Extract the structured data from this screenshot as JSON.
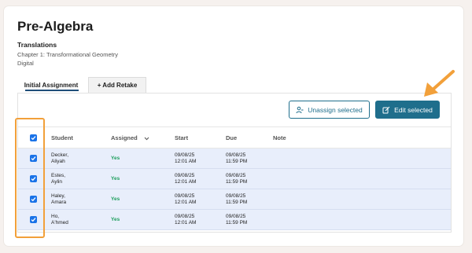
{
  "page": {
    "title": "Pre-Algebra",
    "subtitle": "Translations",
    "chapter": "Chapter 1: Transformational Geometry",
    "format": "Digital"
  },
  "tabs": [
    {
      "label": "Initial Assignment",
      "active": true
    },
    {
      "label": "+ Add Retake",
      "active": false
    }
  ],
  "actions": {
    "unassign_label": "Unassign selected",
    "edit_label": "Edit selected"
  },
  "table": {
    "headers": {
      "student": "Student",
      "assigned": "Assigned",
      "start": "Start",
      "due": "Due",
      "note": "Note"
    },
    "header_checkbox_checked": true,
    "rows": [
      {
        "last": "Decker,",
        "first": "Aliyah",
        "assigned": "Yes",
        "start_date": "09/08/25",
        "start_time": "12:01 AM",
        "due_date": "09/08/25",
        "due_time": "11:59 PM",
        "checked": true
      },
      {
        "last": "Estes,",
        "first": "Aylin",
        "assigned": "Yes",
        "start_date": "09/08/25",
        "start_time": "12:01 AM",
        "due_date": "09/08/25",
        "due_time": "11:59 PM",
        "checked": true
      },
      {
        "last": "Haley,",
        "first": "Amara",
        "assigned": "Yes",
        "start_date": "09/08/25",
        "start_time": "12:01 AM",
        "due_date": "09/08/25",
        "due_time": "11:59 PM",
        "checked": true
      },
      {
        "last": "Ho,",
        "first": "A'hmed",
        "assigned": "Yes",
        "start_date": "09/08/25",
        "start_time": "12:01 AM",
        "due_date": "09/08/25",
        "due_time": "11:59 PM",
        "checked": true
      }
    ]
  },
  "colors": {
    "accent": "#1f6e8c",
    "checkbox": "#1a73e8",
    "assigned_yes": "#1d9e5d",
    "highlight": "#f2a03a",
    "row_selected": "#e8eefb"
  },
  "icons": {
    "unassign": "person-remove-icon",
    "edit": "edit-pencil-icon",
    "sort": "chevron-down-icon",
    "annotation": "orange-arrow"
  }
}
